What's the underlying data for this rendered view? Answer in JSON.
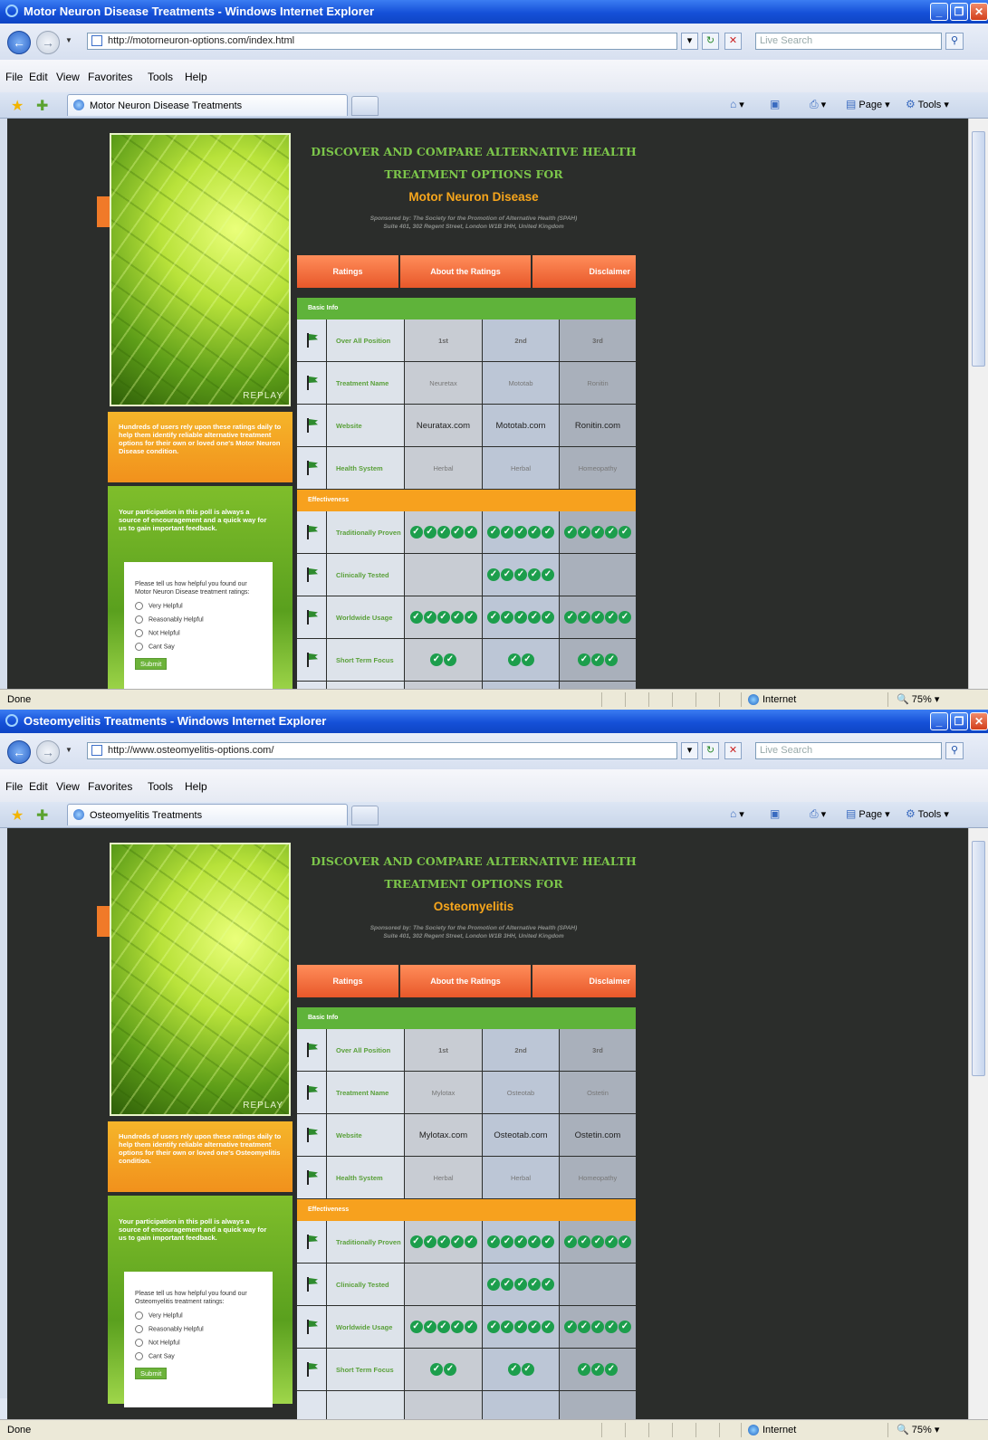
{
  "windows": [
    {
      "title": "Motor Neuron Disease Treatments - Windows Internet Explorer",
      "url": "http://motorneuron-options.com/index.html",
      "tab_label": "Motor Neuron Disease Treatments",
      "condition": "Motor Neuron Disease",
      "users_text": "Hundreds of users rely upon these ratings daily to help them identify reliable alternative treatment options for their own or loved one's Motor Neuron Disease condition.",
      "poll_question": "Please tell us how helpful you found our Motor Neuron Disease treatment ratings:",
      "treatments": [
        "Neuretax",
        "Mototab",
        "Ronitin"
      ],
      "websites": [
        "Neuratax.com",
        "Mototab.com",
        "Ronitin.com"
      ]
    },
    {
      "title": "Osteomyelitis Treatments - Windows Internet Explorer",
      "url": "http://www.osteomyelitis-options.com/",
      "tab_label": "Osteomyelitis Treatments",
      "condition": "Osteomyelitis",
      "users_text": "Hundreds of users rely upon these ratings daily to help them identify reliable alternative treatment options for their own or loved one's Osteomyelitis condition.",
      "poll_question": "Please tell us how helpful you found our Osteomyelitis treatment ratings:",
      "treatments": [
        "Mylotax",
        "Osteotab",
        "Ostetin"
      ],
      "websites": [
        "Mylotax.com",
        "Osteotab.com",
        "Ostetin.com"
      ]
    }
  ],
  "browser": {
    "search_placeholder": "Live Search",
    "menu": [
      "File",
      "Edit",
      "View",
      "Favorites",
      "Tools",
      "Help"
    ],
    "cmd_page": "Page",
    "cmd_tools": "Tools",
    "status_done": "Done",
    "status_zone": "Internet",
    "status_zoom": "75%"
  },
  "page": {
    "headline_line1": "DISCOVER AND COMPARE  ALTERNATIVE HEALTH",
    "headline_line2": "TREATMENT OPTIONS FOR",
    "sponsor_line1": "Sponsored by: The Society for the Promotion of Alternative Health (SPAH)",
    "sponsor_line2": "Suite 401, 302 Regent Street, London W1B 3HH, United Kingdom",
    "replay": "REPLAY",
    "nav": [
      "Ratings",
      "About the Ratings",
      "Disclaimer"
    ],
    "participation_text": "Your participation in this poll is always a source of encouragement and a quick way for us to gain important feedback.",
    "poll_options": [
      "Very Helpful",
      "Reasonably Helpful",
      "Not Helpful",
      "Cant Say"
    ],
    "submit": "Submit",
    "section_basic": "Basic Info",
    "section_effect": "Effectiveness",
    "row_labels": {
      "position": "Over All Position",
      "name": "Treatment Name",
      "website": "Website",
      "health": "Health System",
      "traditional": "Traditionally Proven",
      "clinical": "Clinically Tested",
      "worldwide": "Worldwide Usage",
      "shortterm": "Short Term Focus"
    },
    "positions": [
      "1st",
      "2nd",
      "3rd"
    ],
    "health_systems": [
      "Herbal",
      "Herbal",
      "Homeopathy"
    ],
    "ratings": {
      "traditional": [
        5,
        5,
        5
      ],
      "clinical": [
        0,
        5,
        0
      ],
      "worldwide": [
        5,
        5,
        5
      ],
      "shortterm": [
        2,
        2,
        3
      ]
    }
  }
}
